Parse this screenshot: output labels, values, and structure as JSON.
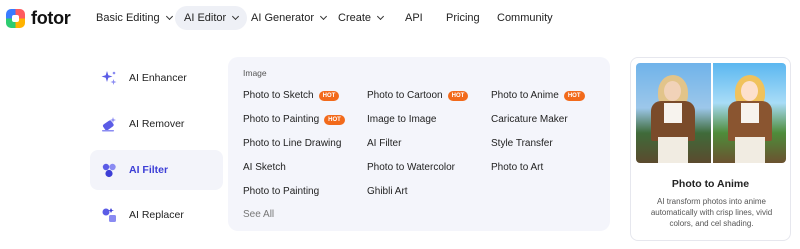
{
  "brand": {
    "name": "fotor"
  },
  "nav": {
    "items": [
      {
        "label": "Basic Editing",
        "dropdown": true
      },
      {
        "label": "AI Editor",
        "dropdown": true,
        "active": true
      },
      {
        "label": "AI Generator",
        "dropdown": true
      },
      {
        "label": "Create",
        "dropdown": true
      },
      {
        "label": "API",
        "dropdown": false
      },
      {
        "label": "Pricing",
        "dropdown": false
      },
      {
        "label": "Community",
        "dropdown": false
      }
    ]
  },
  "left_menu": [
    {
      "label": "AI Enhancer",
      "icon": "sparkle-enhance-icon"
    },
    {
      "label": "AI Remover",
      "icon": "eraser-sparkle-icon"
    },
    {
      "label": "AI Filter",
      "icon": "filter-circles-icon",
      "active": true
    },
    {
      "label": "AI Replacer",
      "icon": "replace-shapes-icon"
    }
  ],
  "panel": {
    "heading": "Image",
    "hot_label": "HOT",
    "columns": [
      [
        {
          "label": "Photo to Sketch",
          "hot": true
        },
        {
          "label": "Photo to Painting",
          "hot": true
        },
        {
          "label": "Photo to Line Drawing",
          "hot": false
        },
        {
          "label": "AI Sketch",
          "hot": false
        },
        {
          "label": "Photo to Painting",
          "hot": false
        }
      ],
      [
        {
          "label": "Photo to Cartoon",
          "hot": true
        },
        {
          "label": "Image to Image",
          "hot": false
        },
        {
          "label": "AI Filter",
          "hot": false
        },
        {
          "label": "Photo to Watercolor",
          "hot": false
        },
        {
          "label": "Ghibli Art",
          "hot": false
        }
      ],
      [
        {
          "label": "Photo to Anime",
          "hot": true
        },
        {
          "label": "Caricature Maker",
          "hot": false
        },
        {
          "label": "Style Transfer",
          "hot": false
        },
        {
          "label": "Photo to Art",
          "hot": false
        }
      ]
    ],
    "see_all": "See All"
  },
  "card": {
    "title": "Photo to Anime",
    "description": "AI transform photos into anime automatically with crisp lines, vivid colors, and cel shading."
  },
  "colors": {
    "accent": "#3c3ed6",
    "hot": "#f26a1b",
    "panel_bg": "#f4f5fb",
    "active_nav_bg": "#eef0f6"
  }
}
